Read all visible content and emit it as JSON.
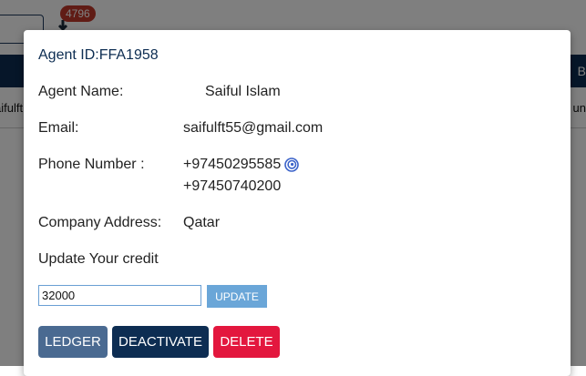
{
  "background": {
    "badge_count": "4796",
    "nav_right_text": "B",
    "row_left_text": "aifulft",
    "row_right_text": "un"
  },
  "modal": {
    "agent_id": "Agent ID:FFA1958",
    "name_label": "Agent Name:",
    "name_value": "Saiful Islam",
    "email_label": "Email:",
    "email_value": "saifulft55@gmail.com",
    "phone_label": "Phone Number :",
    "phone_1": "+97450295585",
    "phone_2": "+97450740200",
    "address_label": "Company Address:",
    "address_value": "Qatar",
    "credit_label": "Update Your credit",
    "credit_value": "32000",
    "update_label": "UPDATE",
    "ledger_label": "LEDGER",
    "deactivate_label": "DEACTIVATE",
    "delete_label": "DELETE"
  },
  "icons": {
    "phone_extension_icon": "spiral-icon"
  },
  "colors": {
    "navy": "#0d2d52",
    "ledger": "#4a6a91",
    "delete": "#e3173e",
    "update": "#6aa6d8",
    "badge": "#c0392b"
  }
}
